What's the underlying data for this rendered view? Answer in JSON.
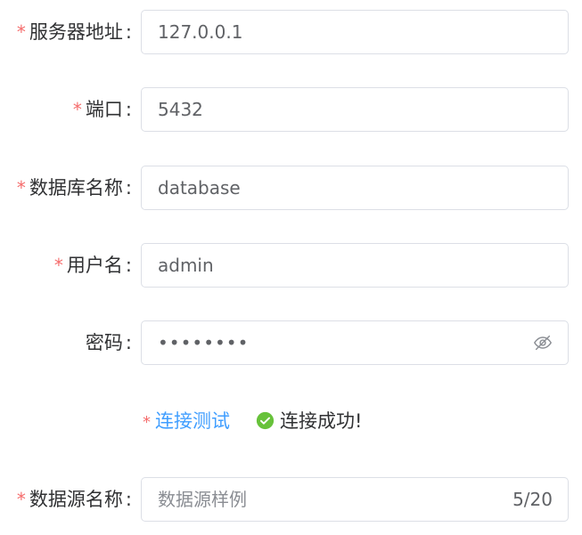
{
  "form": {
    "colon": ":",
    "required_mark": "*",
    "server": {
      "label": "服务器地址",
      "value": "127.0.0.1",
      "required": true
    },
    "port": {
      "label": "端口",
      "value": "5432",
      "required": true
    },
    "database": {
      "label": "数据库名称",
      "value": "database",
      "required": true
    },
    "username": {
      "label": "用户名",
      "value": "admin",
      "required": true
    },
    "password": {
      "label": "密码",
      "value": "••••••••",
      "required": false,
      "toggle_icon": "eye-off-icon"
    },
    "connection_test": {
      "link_label": "连接测试",
      "required": true,
      "status_text": "连接成功!",
      "status_icon": "check-circle-icon",
      "status_color": "#67c23a"
    },
    "datasource_name": {
      "label": "数据源名称",
      "placeholder": "数据源样例",
      "value": "",
      "counter": "5/20",
      "required": true
    }
  },
  "colors": {
    "required": "#f56c6c",
    "link": "#409eff",
    "success": "#67c23a",
    "border": "#dcdfe6"
  }
}
